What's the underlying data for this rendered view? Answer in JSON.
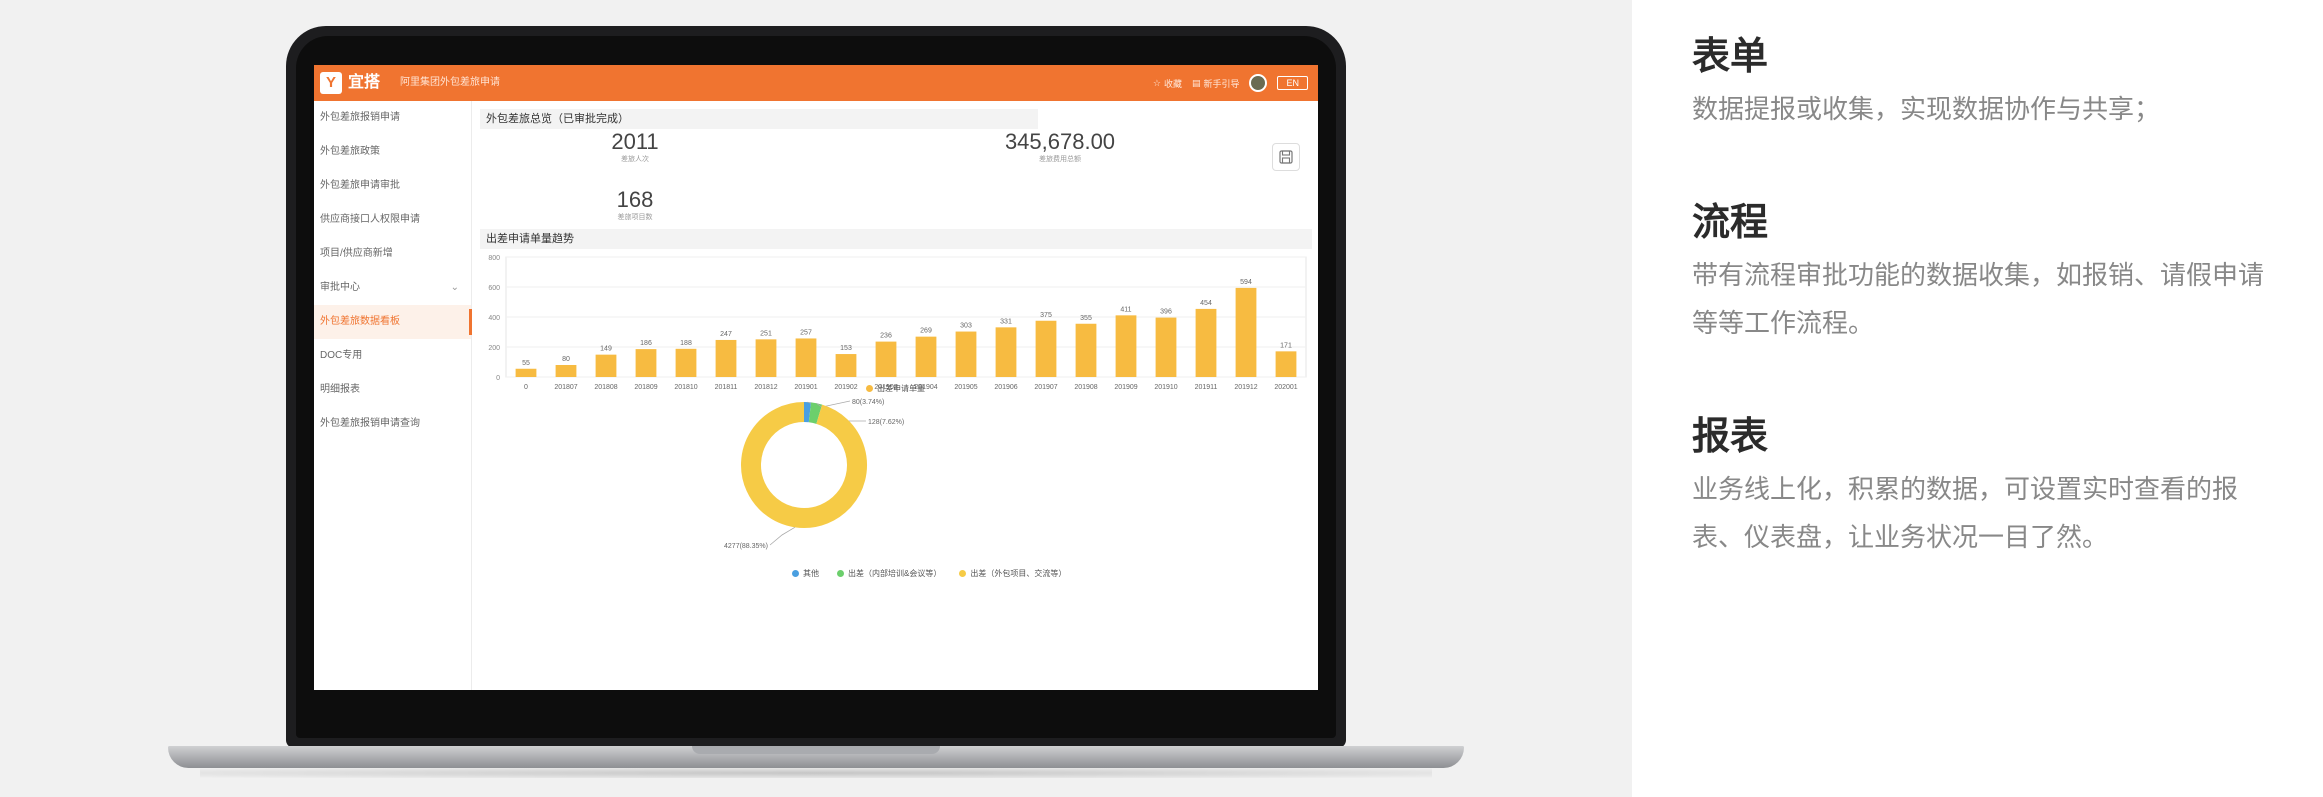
{
  "app": {
    "logo_glyph": "Y",
    "logo_text": "宜搭",
    "title": "阿里集团外包差旅申请",
    "header_items": [
      {
        "icon": "star-icon",
        "label": "收藏"
      },
      {
        "icon": "doc-icon",
        "label": "新手引导"
      }
    ],
    "lang": "EN"
  },
  "sidebar": {
    "items": [
      {
        "label": "外包差旅报销申请",
        "active": false
      },
      {
        "label": "外包差旅政策",
        "active": false
      },
      {
        "label": "外包差旅申请审批",
        "active": false
      },
      {
        "label": "供应商接口人权限申请",
        "active": false
      },
      {
        "label": "项目/供应商新增",
        "active": false
      },
      {
        "label": "审批中心",
        "active": false,
        "chevron": "⌄"
      },
      {
        "label": "外包差旅数据看板",
        "active": true
      },
      {
        "label": "DOC专用",
        "active": false
      },
      {
        "label": "明细报表",
        "active": false
      },
      {
        "label": "外包差旅报销申请查询",
        "active": false
      }
    ]
  },
  "overview": {
    "title": "外包差旅总览（已审批完成）",
    "stats": [
      {
        "value": "2011",
        "label": "差旅人次"
      },
      {
        "value": "345,678.00",
        "label": "差旅费用总额"
      },
      {
        "value": "168",
        "label": "差旅项目数"
      }
    ]
  },
  "trend": {
    "title": "出差申请单量趋势"
  },
  "chart_data": [
    {
      "type": "bar",
      "title": "",
      "categories": [
        "0",
        "201807",
        "201808",
        "201809",
        "201810",
        "201811",
        "201812",
        "201901",
        "201902",
        "201903",
        "201904",
        "201905",
        "201906",
        "201907",
        "201908",
        "201909",
        "201910",
        "201911",
        "201912",
        "202001"
      ],
      "series": [
        {
          "name": "出差申请单量",
          "values": [
            55,
            80,
            149,
            186,
            188,
            247,
            251,
            257,
            153,
            236,
            269,
            303,
            331,
            375,
            355,
            411,
            396,
            454,
            594,
            171
          ]
        }
      ],
      "yticks": [
        0,
        200,
        400,
        600,
        800
      ],
      "ylim": [
        0,
        800
      ],
      "color": "#f7bb41",
      "legend_position": "bottom"
    },
    {
      "type": "pie",
      "title": "",
      "slices": [
        {
          "name": "其他",
          "value": 80,
          "label": "80(3.74%)",
          "color": "#4a9fe0"
        },
        {
          "name": "出差（内部培训&会议等）",
          "value": 128,
          "label": "128(7.62%)",
          "color": "#6ccf6c"
        },
        {
          "name": "出差（外包项目、交流等）",
          "value": 4277,
          "label": "4277(88.35%)",
          "color": "#f6cb46"
        }
      ],
      "legend_position": "bottom"
    }
  ],
  "features": [
    {
      "title": "表单",
      "desc": "数据提报或收集，实现数据协作与共享；"
    },
    {
      "title": "流程",
      "desc": "带有流程审批功能的数据收集，如报销、请假申请等等工作流程。"
    },
    {
      "title": "报表",
      "desc": "业务线上化，积累的数据，可设置实时查看的报表、仪表盘，让业务状况一目了然。"
    }
  ]
}
